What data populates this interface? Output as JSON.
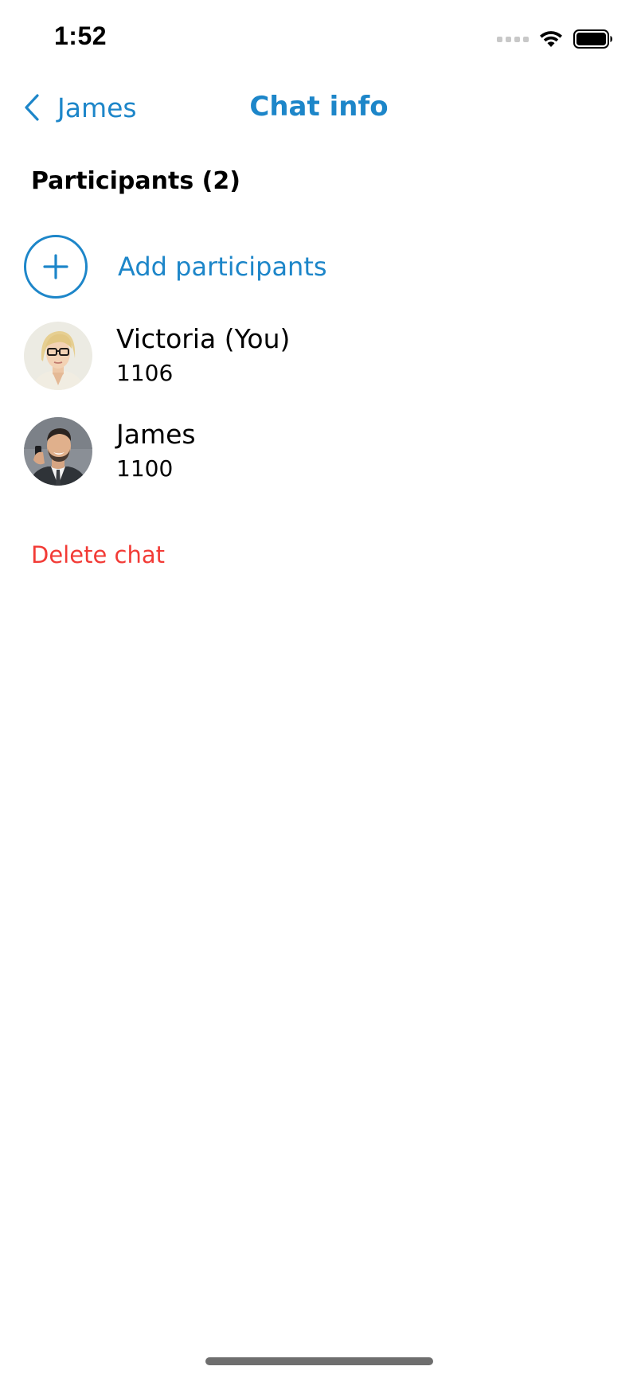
{
  "status_bar": {
    "time": "1:52",
    "signal_icon": "signal-dots-icon",
    "wifi_icon": "wifi-icon",
    "battery_icon": "battery-icon"
  },
  "nav": {
    "back_label": "James",
    "back_icon": "chevron-left-icon",
    "title": "Chat info"
  },
  "participants_section": {
    "header": "Participants (2)",
    "add_label": "Add participants",
    "add_icon": "plus-icon",
    "items": [
      {
        "name": "Victoria (You)",
        "extension": "1106",
        "avatar": "avatar-woman-glasses"
      },
      {
        "name": "James",
        "extension": "1100",
        "avatar": "avatar-man-phone"
      }
    ]
  },
  "actions": {
    "delete_label": "Delete chat"
  },
  "colors": {
    "accent": "#1d86c9",
    "destructive": "#f23b36",
    "background": "#ffffff"
  }
}
